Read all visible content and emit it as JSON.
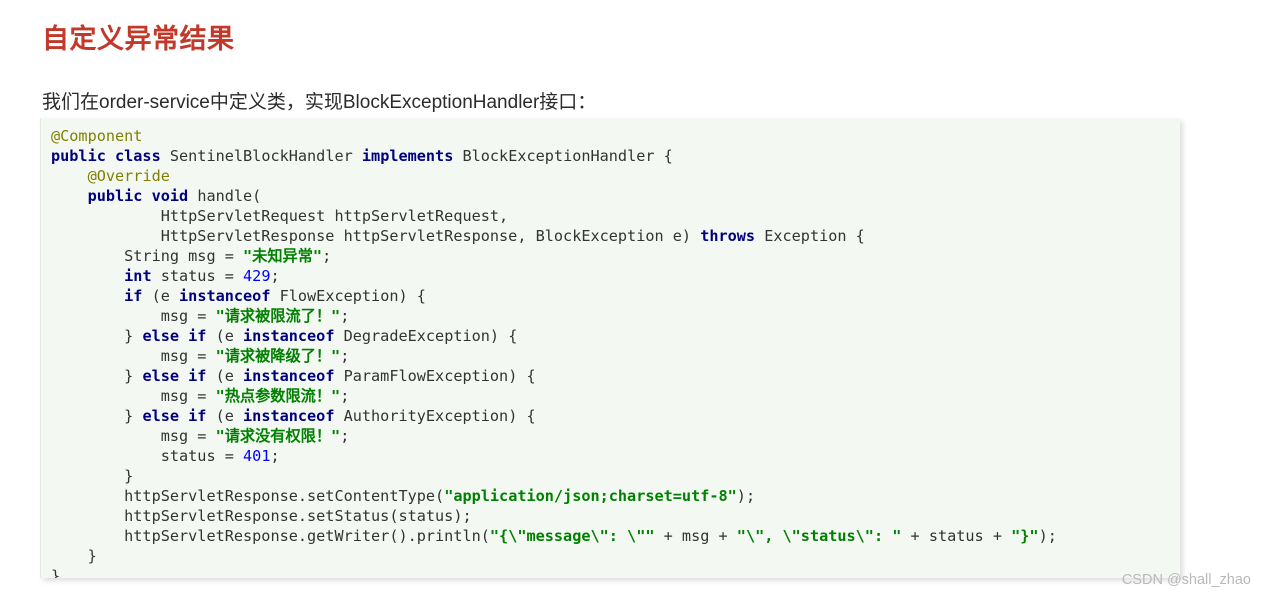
{
  "page": {
    "title": "自定义异常结果",
    "title_color": "#c0392b",
    "intro": "我们在order-service中定义类，实现BlockExceptionHandler接口："
  },
  "watermark": {
    "text": "CSDN @shall_zhao"
  },
  "code_block": {
    "language": "java",
    "background": "#f4f8f2",
    "colors": {
      "annotation": "#808000",
      "keyword": "#000080",
      "string": "#008000",
      "number": "#0000ff",
      "plain": "#333333"
    },
    "lines": [
      [
        {
          "t": "@Component",
          "c": "ann"
        }
      ],
      [
        {
          "t": "public class",
          "c": "kw"
        },
        {
          "t": " SentinelBlockHandler ",
          "c": "plain"
        },
        {
          "t": "implements",
          "c": "kw"
        },
        {
          "t": " BlockExceptionHandler {",
          "c": "plain"
        }
      ],
      [
        {
          "t": "    ",
          "c": "plain"
        },
        {
          "t": "@Override",
          "c": "ann"
        }
      ],
      [
        {
          "t": "    ",
          "c": "plain"
        },
        {
          "t": "public void",
          "c": "kw"
        },
        {
          "t": " handle(",
          "c": "plain"
        }
      ],
      [
        {
          "t": "            HttpServletRequest httpServletRequest,",
          "c": "plain"
        }
      ],
      [
        {
          "t": "            HttpServletResponse httpServletResponse, BlockException e) ",
          "c": "plain"
        },
        {
          "t": "throws",
          "c": "kw"
        },
        {
          "t": " Exception {",
          "c": "plain"
        }
      ],
      [
        {
          "t": "        String msg = ",
          "c": "plain"
        },
        {
          "t": "\"未知异常\"",
          "c": "str"
        },
        {
          "t": ";",
          "c": "plain"
        }
      ],
      [
        {
          "t": "        ",
          "c": "plain"
        },
        {
          "t": "int",
          "c": "kw"
        },
        {
          "t": " status = ",
          "c": "plain"
        },
        {
          "t": "429",
          "c": "num"
        },
        {
          "t": ";",
          "c": "plain"
        }
      ],
      [
        {
          "t": "        ",
          "c": "plain"
        },
        {
          "t": "if",
          "c": "kw"
        },
        {
          "t": " (e ",
          "c": "plain"
        },
        {
          "t": "instanceof",
          "c": "kw"
        },
        {
          "t": " FlowException) {",
          "c": "plain"
        }
      ],
      [
        {
          "t": "            msg = ",
          "c": "plain"
        },
        {
          "t": "\"请求被限流了！\"",
          "c": "str"
        },
        {
          "t": ";",
          "c": "plain"
        }
      ],
      [
        {
          "t": "        } ",
          "c": "plain"
        },
        {
          "t": "else if",
          "c": "kw"
        },
        {
          "t": " (e ",
          "c": "plain"
        },
        {
          "t": "instanceof",
          "c": "kw"
        },
        {
          "t": " DegradeException) {",
          "c": "plain"
        }
      ],
      [
        {
          "t": "            msg = ",
          "c": "plain"
        },
        {
          "t": "\"请求被降级了！\"",
          "c": "str"
        },
        {
          "t": ";",
          "c": "plain"
        }
      ],
      [
        {
          "t": "        } ",
          "c": "plain"
        },
        {
          "t": "else if",
          "c": "kw"
        },
        {
          "t": " (e ",
          "c": "plain"
        },
        {
          "t": "instanceof",
          "c": "kw"
        },
        {
          "t": " ParamFlowException) {",
          "c": "plain"
        }
      ],
      [
        {
          "t": "            msg = ",
          "c": "plain"
        },
        {
          "t": "\"热点参数限流！\"",
          "c": "str"
        },
        {
          "t": ";",
          "c": "plain"
        }
      ],
      [
        {
          "t": "        } ",
          "c": "plain"
        },
        {
          "t": "else if",
          "c": "kw"
        },
        {
          "t": " (e ",
          "c": "plain"
        },
        {
          "t": "instanceof",
          "c": "kw"
        },
        {
          "t": " AuthorityException) {",
          "c": "plain"
        }
      ],
      [
        {
          "t": "            msg = ",
          "c": "plain"
        },
        {
          "t": "\"请求没有权限！\"",
          "c": "str"
        },
        {
          "t": ";",
          "c": "plain"
        }
      ],
      [
        {
          "t": "            status = ",
          "c": "plain"
        },
        {
          "t": "401",
          "c": "num"
        },
        {
          "t": ";",
          "c": "plain"
        }
      ],
      [
        {
          "t": "        }",
          "c": "plain"
        }
      ],
      [
        {
          "t": "        httpServletResponse.setContentType(",
          "c": "plain"
        },
        {
          "t": "\"application/json;charset=utf-8\"",
          "c": "str"
        },
        {
          "t": ");",
          "c": "plain"
        }
      ],
      [
        {
          "t": "        httpServletResponse.setStatus(status);",
          "c": "plain"
        }
      ],
      [
        {
          "t": "        httpServletResponse.getWriter().println(",
          "c": "plain"
        },
        {
          "t": "\"{\\\"message\\\": \\\"\"",
          "c": "str"
        },
        {
          "t": " + msg + ",
          "c": "plain"
        },
        {
          "t": "\"\\\", \\\"status\\\": \"",
          "c": "str"
        },
        {
          "t": " + status + ",
          "c": "plain"
        },
        {
          "t": "\"}\"",
          "c": "str"
        },
        {
          "t": ");",
          "c": "plain"
        }
      ],
      [
        {
          "t": "    }",
          "c": "plain"
        }
      ],
      [
        {
          "t": "}",
          "c": "plain"
        }
      ]
    ]
  }
}
